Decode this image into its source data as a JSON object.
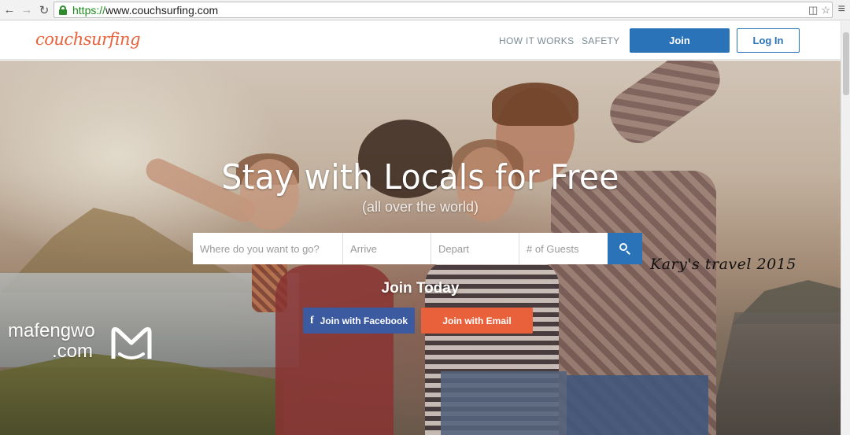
{
  "browser": {
    "url_scheme": "https://",
    "url_rest": "www.couchsurfing.com"
  },
  "header": {
    "logo": "couchsurfing",
    "nav": [
      "HOW IT WORKS",
      "SAFETY"
    ],
    "join_label": "Join",
    "login_label": "Log In"
  },
  "hero": {
    "title": "Stay with Locals for Free",
    "subtitle": "(all over the world)",
    "search": {
      "where_placeholder": "Where do you want to go?",
      "arrive_placeholder": "Arrive",
      "depart_placeholder": "Depart",
      "guests_placeholder": "# of Guests"
    },
    "join_today": "Join Today",
    "facebook_label": "Join with Facebook",
    "email_label": "Join with Email"
  },
  "watermarks": {
    "kary": "Kary's travel 2015",
    "mafengwo_line1": "mafengwo",
    "mafengwo_line2": ".com"
  },
  "colors": {
    "brand_orange": "#e8613a",
    "brand_blue": "#2a73b8",
    "facebook_blue": "#3b5aa0"
  }
}
